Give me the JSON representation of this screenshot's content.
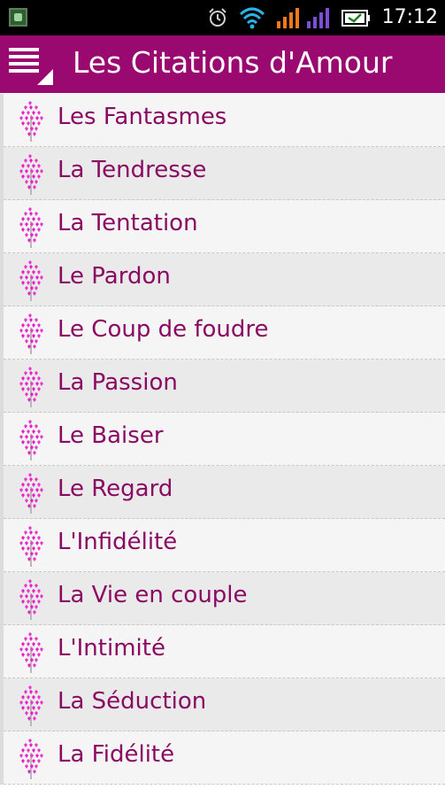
{
  "status_bar": {
    "time": "17:12",
    "icons": [
      "app-icon",
      "alarm-icon",
      "wifi-icon",
      "signal-icon",
      "signal-icon",
      "battery-icon"
    ]
  },
  "app_bar": {
    "title": "Les Citations d'Amour",
    "menu_icon": "menu-icon",
    "background": "#99096f"
  },
  "categories": [
    {
      "label": "Les Fantasmes",
      "icon": "heart-tree-icon"
    },
    {
      "label": "La Tendresse",
      "icon": "heart-tree-icon"
    },
    {
      "label": "La Tentation",
      "icon": "heart-tree-icon"
    },
    {
      "label": "Le Pardon",
      "icon": "heart-tree-icon"
    },
    {
      "label": "Le Coup de foudre",
      "icon": "heart-tree-icon"
    },
    {
      "label": "La Passion",
      "icon": "heart-tree-icon"
    },
    {
      "label": "Le Baiser",
      "icon": "heart-tree-icon"
    },
    {
      "label": "Le Regard",
      "icon": "heart-tree-icon"
    },
    {
      "label": "L'Infidélité",
      "icon": "heart-tree-icon"
    },
    {
      "label": "La Vie en couple",
      "icon": "heart-tree-icon"
    },
    {
      "label": "L'Intimité",
      "icon": "heart-tree-icon"
    },
    {
      "label": "La Séduction",
      "icon": "heart-tree-icon"
    },
    {
      "label": "La Fidélité",
      "icon": "heart-tree-icon"
    }
  ],
  "colors": {
    "accent": "#99096f",
    "label_text": "#8a0a63",
    "icon_pink": "#e620c8"
  }
}
